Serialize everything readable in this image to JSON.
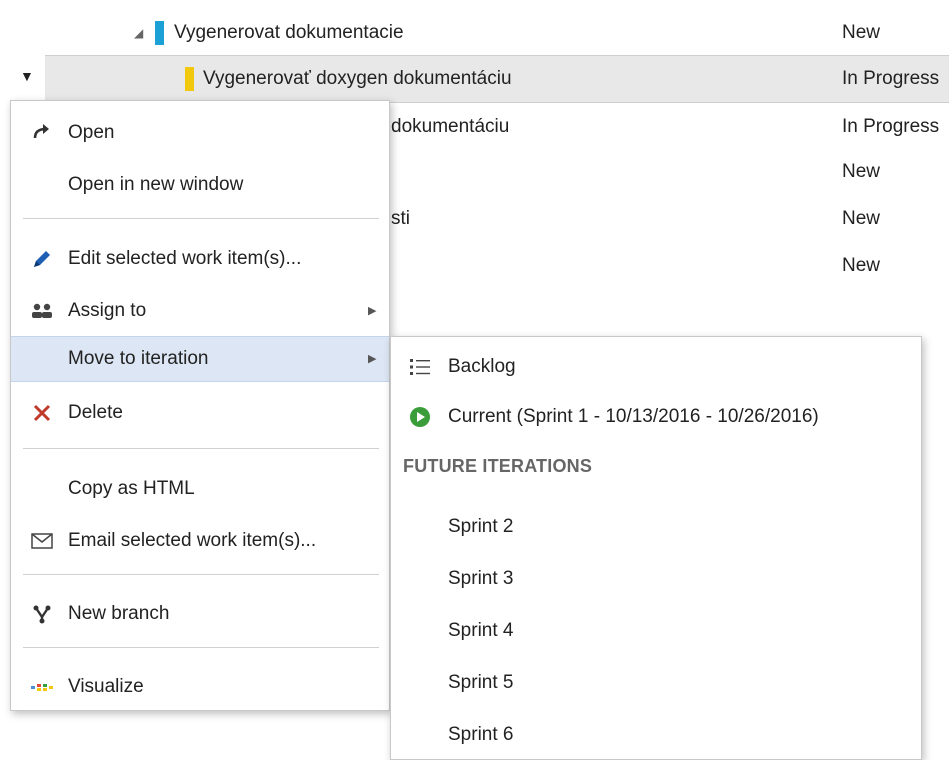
{
  "work_items": [
    {
      "title": "Vygenerovat dokumentacie",
      "state": "New",
      "color": "#1ba1d6"
    },
    {
      "title": "Vygenerovať doxygen dokumentáciu",
      "state": "In Progress",
      "color": "#f2c80f"
    },
    {
      "title": "dokumentáciu",
      "state": "In Progress"
    },
    {
      "title": "",
      "state": "New"
    },
    {
      "title": "sti",
      "state": "New"
    },
    {
      "title": "",
      "state": "New"
    }
  ],
  "context_menu": {
    "open": "Open",
    "open_new_window": "Open in new window",
    "edit_selected": "Edit selected work item(s)...",
    "assign_to": "Assign to",
    "move_to_iteration": "Move to iteration",
    "delete": "Delete",
    "copy_as_html": "Copy as HTML",
    "email_selected": "Email selected work item(s)...",
    "new_branch": "New branch",
    "visualize": "Visualize"
  },
  "iteration_submenu": {
    "backlog": "Backlog",
    "current": "Current (Sprint 1 - 10/13/2016 - 10/26/2016)",
    "future_header": "FUTURE ITERATIONS",
    "sprints": [
      "Sprint 2",
      "Sprint 3",
      "Sprint 4",
      "Sprint 5",
      "Sprint 6"
    ]
  },
  "colors": {
    "delete_icon": "#c0392b",
    "current_icon": "#3a9d3a",
    "edit_icon": "#1e5fb4",
    "hover_bg": "#dce6f4"
  },
  "icons": {
    "open": "redo-arrow-icon",
    "edit": "pencil-icon",
    "assign": "people-icon",
    "delete": "x-icon",
    "email": "envelope-icon",
    "branch": "branch-icon",
    "visualize": "visualize-icon",
    "backlog": "list-icon",
    "current": "play-circle-icon"
  }
}
